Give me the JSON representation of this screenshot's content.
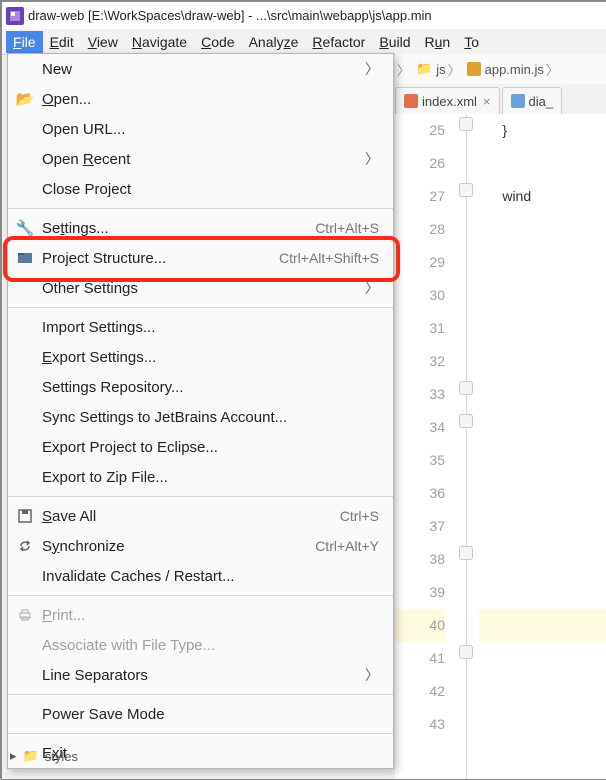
{
  "title": "draw-web [E:\\WorkSpaces\\draw-web] - ...\\src\\main\\webapp\\js\\app.min",
  "menubar": {
    "file": "File",
    "edit": "Edit",
    "view": "View",
    "navigate": "Navigate",
    "code": "Code",
    "analyze": "Analyze",
    "refactor": "Refactor",
    "build": "Build",
    "run": "Run",
    "to": "To"
  },
  "breadcrumbs": {
    "folder": "js",
    "file": "app.min.js"
  },
  "tabs": {
    "a": {
      "label": "index.xml"
    },
    "b": {
      "label": "dia_"
    }
  },
  "file_menu": {
    "new": "New",
    "open": "Open...",
    "open_url": "Open URL...",
    "open_recent": "Open Recent",
    "close_project": "Close Project",
    "settings": "Settings...",
    "settings_sc": "Ctrl+Alt+S",
    "project_structure": "Project Structure...",
    "project_structure_sc": "Ctrl+Alt+Shift+S",
    "other_settings": "Other Settings",
    "import_settings": "Import Settings...",
    "export_settings": "Export Settings...",
    "settings_repo": "Settings Repository...",
    "sync_jetbrains": "Sync Settings to JetBrains Account...",
    "export_eclipse": "Export Project to Eclipse...",
    "export_zip": "Export to Zip File...",
    "save_all": "Save All",
    "save_all_sc": "Ctrl+S",
    "synchronize": "Synchronize",
    "synchronize_sc": "Ctrl+Alt+Y",
    "invalidate": "Invalidate Caches / Restart...",
    "print": "Print...",
    "associate": "Associate with File Type...",
    "line_sep": "Line Separators",
    "power_save": "Power Save Mode",
    "exit": "Exit"
  },
  "code": {
    "lines": [
      25,
      26,
      27,
      28,
      29,
      30,
      31,
      32,
      33,
      34,
      35,
      36,
      37,
      38,
      39,
      40,
      41,
      42,
      43
    ],
    "l25": "      }",
    "l27": "      wind",
    "highlighted_line": 40
  },
  "tree_foot": "styles"
}
